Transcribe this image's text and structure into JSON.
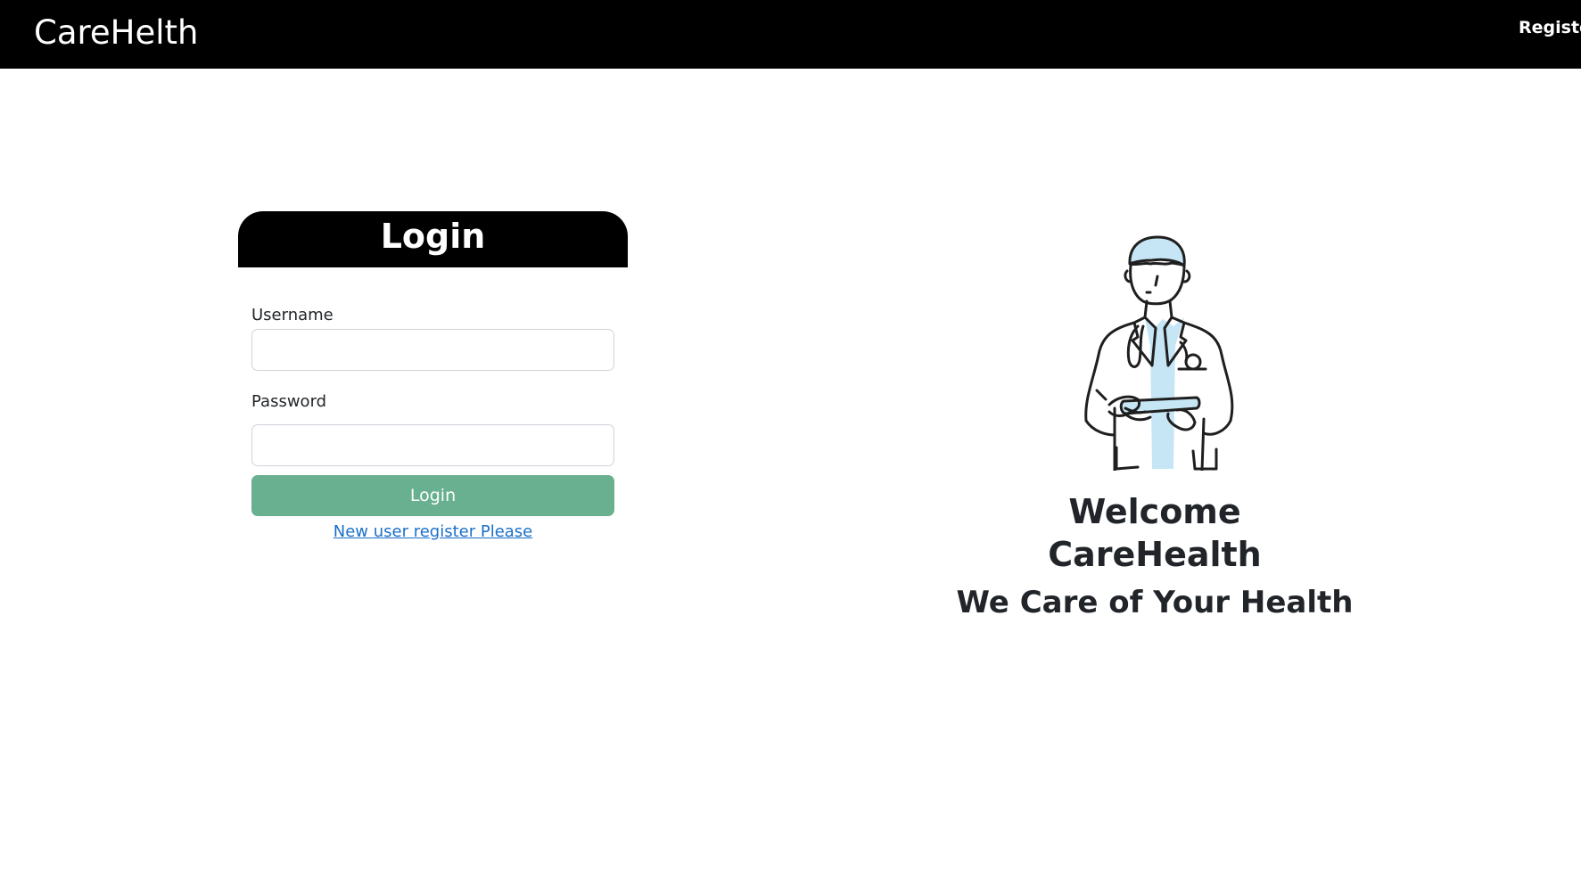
{
  "navbar": {
    "brand": "CareHelth",
    "register_link": "Register",
    "background_color": "#000000"
  },
  "login": {
    "title": "Login",
    "username_label": "Username",
    "username_value": "",
    "password_label": "Password",
    "password_value": "",
    "submit_label": "Login",
    "register_link": "New user register Please",
    "button_color": "#68b08f",
    "link_color": "#1a6fc9"
  },
  "hero": {
    "illustration": "doctor-illustration",
    "welcome_line_1": "Welcome",
    "welcome_line_2": "CareHealth",
    "tagline": "We Care of Your Health",
    "accent_color": "#c6e6f5"
  }
}
